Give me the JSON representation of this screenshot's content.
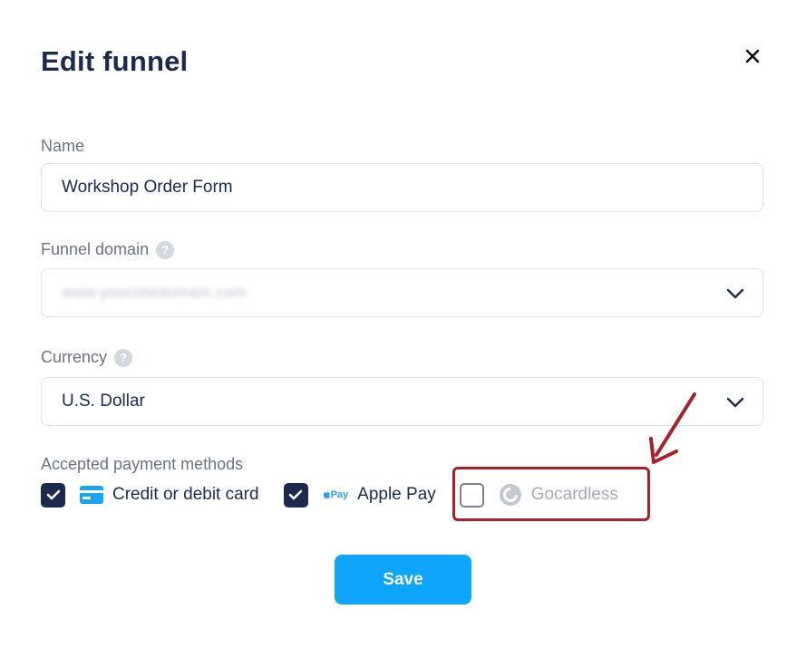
{
  "modal": {
    "title": "Edit funnel",
    "close_icon": "close-icon"
  },
  "name": {
    "label": "Name",
    "value": "Workshop Order Form"
  },
  "domain": {
    "label": "Funnel domain",
    "help": "?",
    "value": "www.yoursitedomain.com"
  },
  "currency": {
    "label": "Currency",
    "help": "?",
    "value": "U.S. Dollar"
  },
  "payments": {
    "label": "Accepted payment methods",
    "options": [
      {
        "label": "Credit or debit card",
        "checked": true,
        "icon": "credit-card-icon"
      },
      {
        "label": "Apple Pay",
        "checked": true,
        "icon": "apple-pay-icon",
        "icon_text": "Pay"
      },
      {
        "label": "Gocardless",
        "checked": false,
        "icon": "gocardless-icon"
      }
    ]
  },
  "save_label": "Save",
  "colors": {
    "primary": "#1b2a4e",
    "accent": "#0ea5ff",
    "highlight": "#a8202a"
  }
}
